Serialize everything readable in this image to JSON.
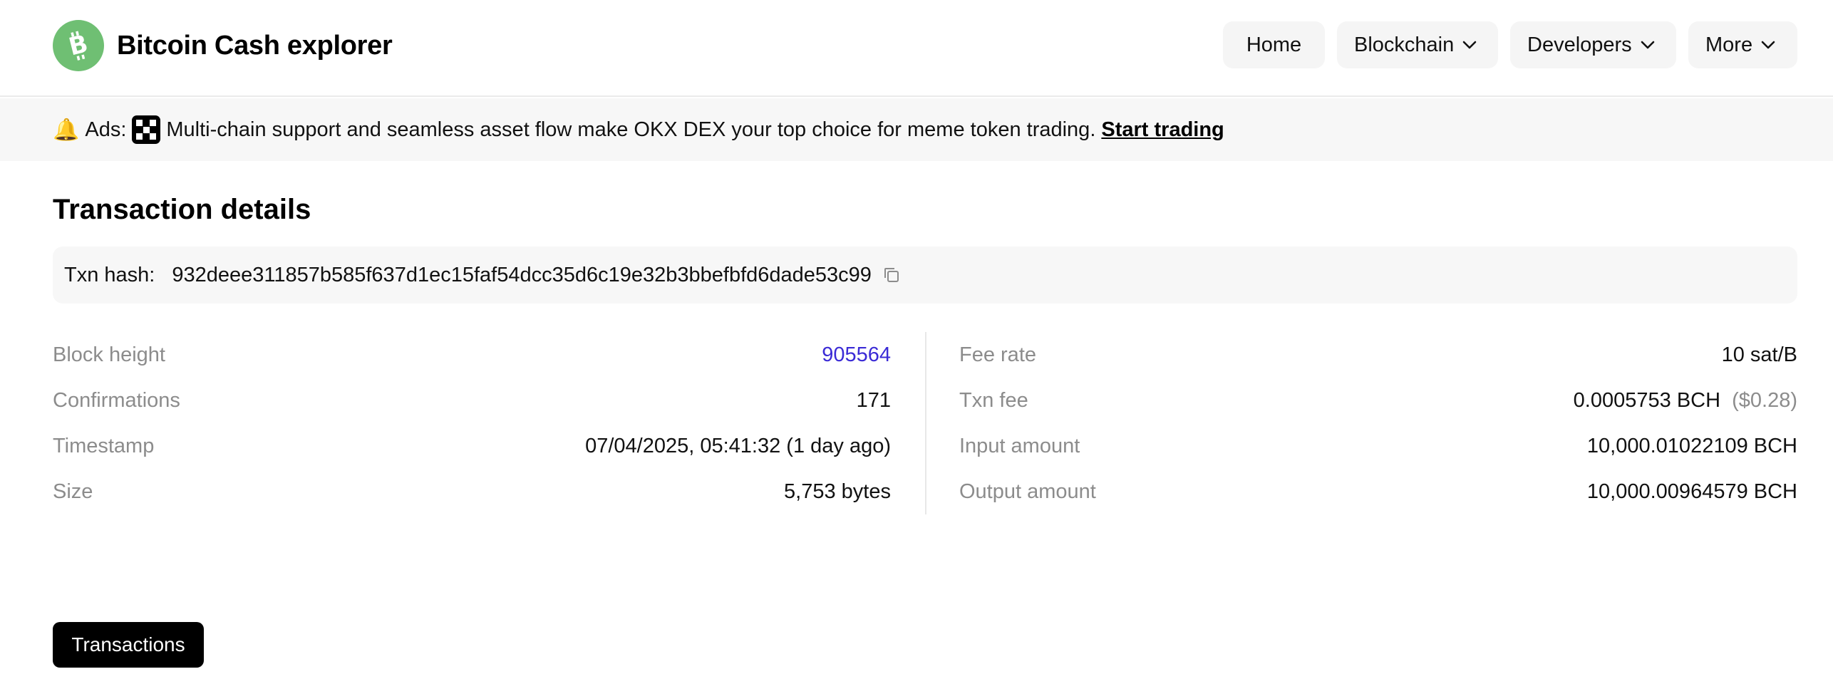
{
  "brand": {
    "title": "Bitcoin Cash explorer",
    "logo_color": "#6fbf73",
    "logo_icon": "bitcoin-cash-icon"
  },
  "nav": {
    "home": "Home",
    "blockchain": "Blockchain",
    "developers": "Developers",
    "more": "More"
  },
  "ad": {
    "label": "Ads:",
    "text": "Multi-chain support and seamless asset flow make OKX DEX your top choice for meme token trading.",
    "cta": "Start trading"
  },
  "page_title": "Transaction details",
  "txn": {
    "hash_label": "Txn hash:",
    "hash": "932deee311857b585f637d1ec15faf54dcc35d6c19e32b3bbefbfd6dade53c99"
  },
  "details_left": [
    {
      "label": "Block height",
      "value": "905564"
    },
    {
      "label": "Confirmations",
      "value": "171"
    },
    {
      "label": "Timestamp",
      "value": "07/04/2025, 05:41:32 (1 day ago)"
    },
    {
      "label": "Size",
      "value": "5,753 bytes"
    }
  ],
  "details_right": [
    {
      "label": "Fee rate",
      "value": "10 sat/B"
    },
    {
      "label": "Txn fee",
      "value": "0.0005753 BCH",
      "extra": "($0.28)"
    },
    {
      "label": "Input amount",
      "value": "10,000.01022109 BCH"
    },
    {
      "label": "Output amount",
      "value": "10,000.00964579 BCH"
    }
  ],
  "tabs": {
    "transactions": "Transactions"
  },
  "colors": {
    "link": "#3b2bd6",
    "muted": "#8c8c8c",
    "accent_green": "#6fbf73"
  }
}
